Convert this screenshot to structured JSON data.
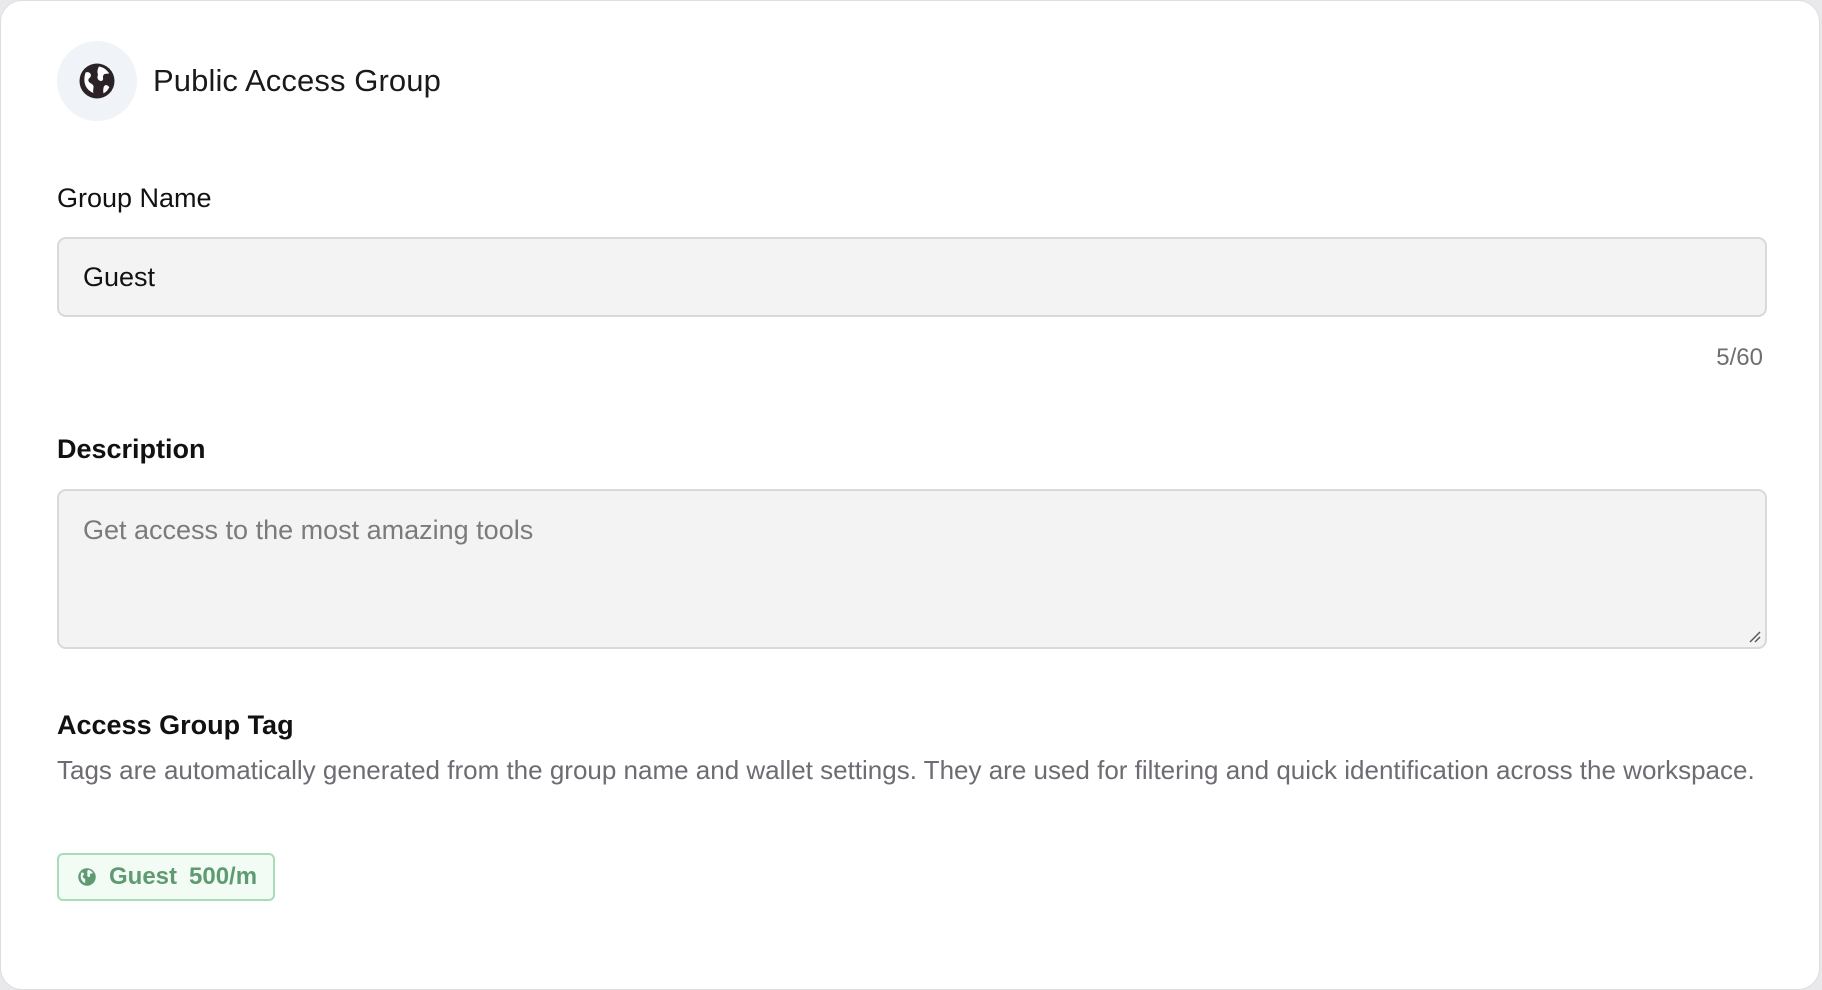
{
  "header": {
    "title": "Public Access Group",
    "icon": "globe-icon"
  },
  "group_name": {
    "label": "Group Name",
    "value": "Guest",
    "counter": "5/60"
  },
  "description": {
    "label": "Description",
    "placeholder": "Get access to the most amazing tools",
    "value": ""
  },
  "access_group_tag": {
    "label": "Access Group Tag",
    "help": "Tags are automatically generated from the group name and wallet settings. They are used for filtering and quick identification across the workspace.",
    "tag": {
      "icon": "globe-icon",
      "name": "Guest",
      "rate": "500/m"
    }
  },
  "colors": {
    "tag_text": "#5f9b72",
    "tag_border": "#a9dcb8",
    "input_bg": "#f3f3f3",
    "muted_text": "#6e6b73"
  }
}
